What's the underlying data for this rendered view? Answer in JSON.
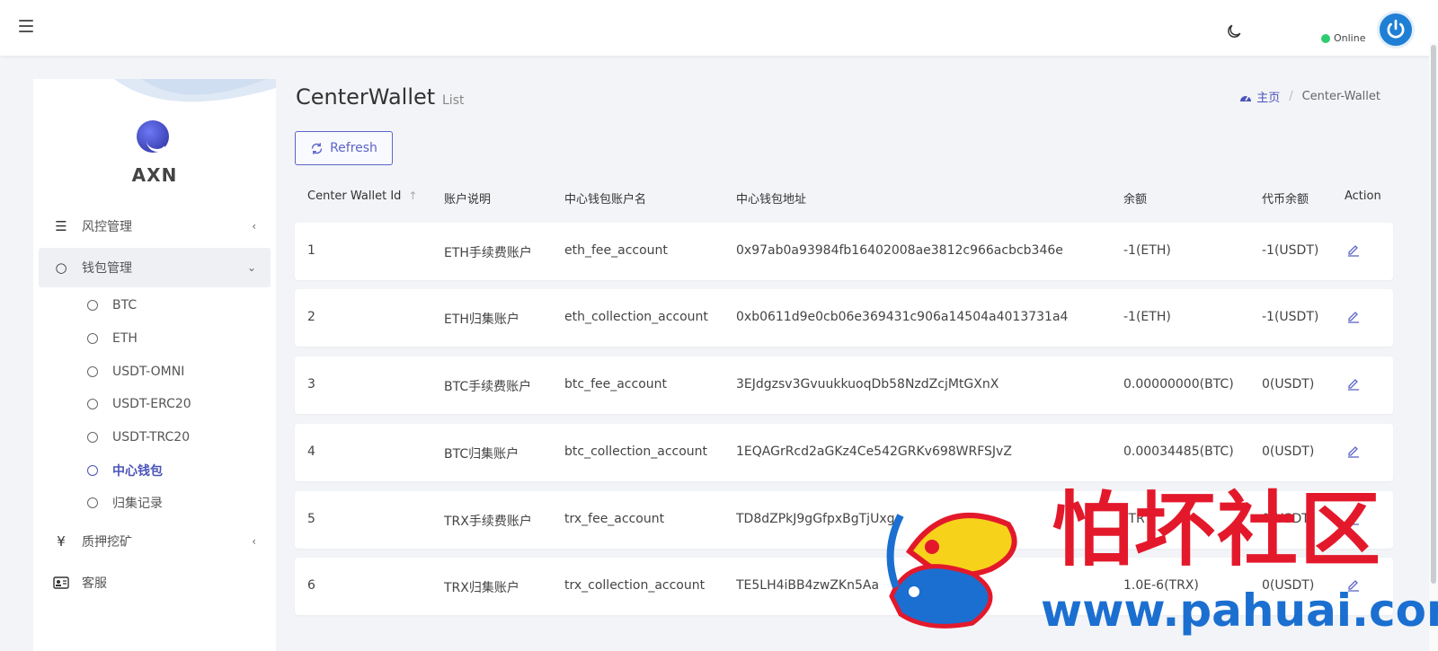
{
  "topbar": {
    "status_text": "Online"
  },
  "sidebar": {
    "brand": "AXN",
    "menu": [
      {
        "label": "风控管理",
        "icon": "list-icon"
      },
      {
        "label": "钱包管理",
        "icon": "circle-icon"
      },
      {
        "label": "质押挖矿",
        "icon": "yen-icon"
      },
      {
        "label": "客服",
        "icon": "id-card-icon"
      }
    ],
    "wallet_sub": [
      "BTC",
      "ETH",
      "USDT-OMNI",
      "USDT-ERC20",
      "USDT-TRC20",
      "中心钱包",
      "归集记录"
    ]
  },
  "page": {
    "title": "CenterWallet",
    "subtitle": "List",
    "breadcrumb_home": "主页",
    "breadcrumb_current": "Center-Wallet",
    "refresh_label": "Refresh"
  },
  "table": {
    "headers": [
      "Center Wallet Id",
      "账户说明",
      "中心钱包账户名",
      "中心钱包地址",
      "余额",
      "代币余额",
      "Action"
    ],
    "rows": [
      [
        "1",
        "ETH手续费账户",
        "eth_fee_account",
        "0x97ab0a93984fb16402008ae3812c966acbcb346e",
        "-1(ETH)",
        "-1(USDT)"
      ],
      [
        "2",
        "ETH归集账户",
        "eth_collection_account",
        "0xb0611d9e0cb06e369431c906a14504a4013731a4",
        "-1(ETH)",
        "-1(USDT)"
      ],
      [
        "3",
        "BTC手续费账户",
        "btc_fee_account",
        "3EJdgzsv3GvuukkuoqDb58NzdZcjMtGXnX",
        "0.00000000(BTC)",
        "0(USDT)"
      ],
      [
        "4",
        "BTC归集账户",
        "btc_collection_account",
        "1EQAGrRcd2aGKz4Ce542GRKv698WRFSJvZ",
        "0.00034485(BTC)",
        "0(USDT)"
      ],
      [
        "5",
        "TRX手续费账户",
        "trx_fee_account",
        "TD8dZPkJ9gGfpxBgTjUxg",
        "(TR",
        "0(USDT)"
      ],
      [
        "6",
        "TRX归集账户",
        "trx_collection_account",
        "TE5LH4iBB4zwZKn5Aa",
        "1.0E-6(TRX)",
        "0(USDT)"
      ]
    ]
  },
  "watermark": {
    "text": "怕坏社区",
    "url": "www.pahuai.com"
  },
  "colors": {
    "accent": "#4b54b8",
    "online": "#2ecc71",
    "watermark_red": "#e3192b",
    "watermark_blue": "#1b6fd0"
  }
}
